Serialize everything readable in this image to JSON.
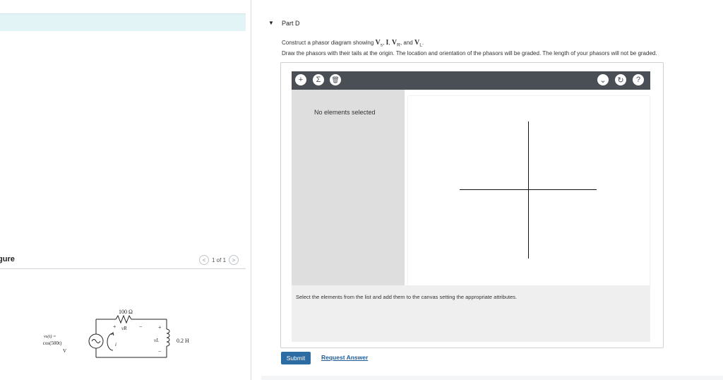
{
  "figure": {
    "label": "igure",
    "pager": {
      "prev": "<",
      "text": "1 of 1",
      "next": ">"
    },
    "circuit": {
      "resistor": "100 Ω",
      "vr": "vR",
      "source_line1": "vs(t) =",
      "source_line2": "10 cos(500t)",
      "source_line3": "V",
      "current": "i",
      "vl": "vL",
      "inductor": "0.2 H",
      "plus": "+",
      "minus": "−"
    }
  },
  "part": {
    "caret": "▼",
    "title": "Part D",
    "instruction_prefix": "Construct a phasor diagram showing ",
    "vs": "V",
    "vs_sub": "s",
    "sep1": ", ",
    "I": "I",
    "sep2": ", ",
    "vr": "V",
    "vr_sub": "R",
    "sep3": ", and ",
    "vl": "V",
    "vl_sub": "L",
    "end": ".",
    "instruction2": "Draw the phasors with their tails at the origin. The location and orientation of the phasors will be graded. The length of your phasors will not be graded."
  },
  "tool": {
    "add_icon": "+",
    "sigma_icon": "Σ",
    "trash_icon": "🗑",
    "dropdown_icon": "⌄",
    "reset_icon": "↻",
    "help_icon": "?",
    "no_elements": "No elements selected",
    "hint": "Select the elements from the list and add them to the canvas setting the appropriate attributes."
  },
  "actions": {
    "submit": "Submit",
    "request": "Request Answer"
  }
}
